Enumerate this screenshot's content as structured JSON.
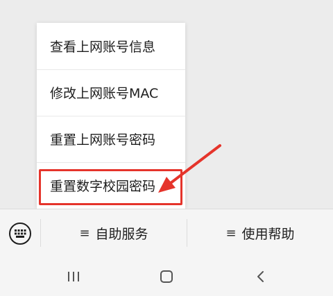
{
  "popup_menu": {
    "items": [
      {
        "label": "查看上网账号信息"
      },
      {
        "label": "修改上网账号MAC"
      },
      {
        "label": "重置上网账号密码"
      },
      {
        "label": "重置数字校园密码"
      }
    ]
  },
  "annotation": {
    "highlight_color": "#e5342b",
    "highlighted_item": "重置数字校园密码"
  },
  "menu_bar": {
    "keyboard_icon": "keyboard-icon",
    "tabs": [
      {
        "glyph": "≡",
        "label": "自助服务"
      },
      {
        "glyph": "≡",
        "label": "使用帮助"
      }
    ]
  },
  "system_nav": {
    "buttons": [
      "recents-icon",
      "home-icon",
      "back-icon"
    ]
  }
}
